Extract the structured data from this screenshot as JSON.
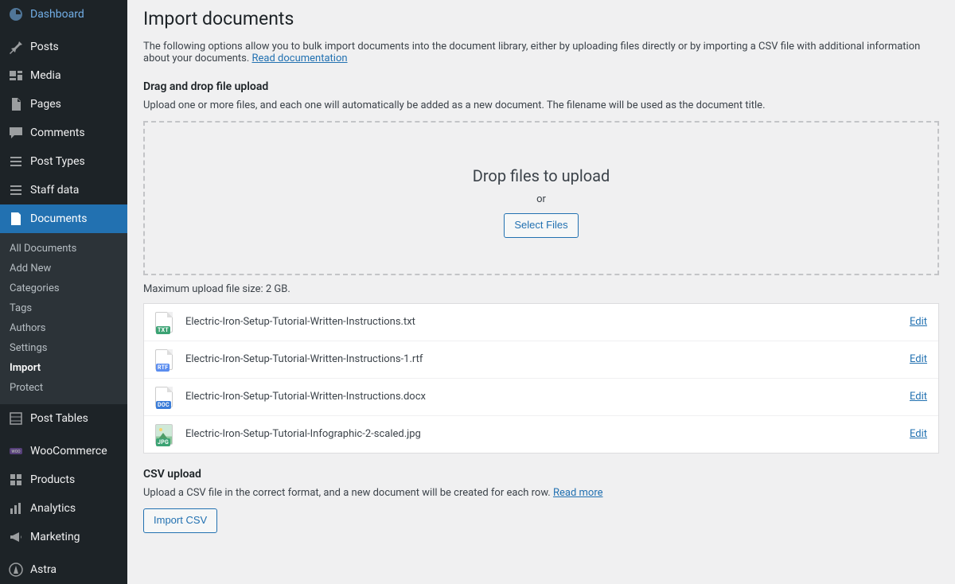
{
  "sidebar": {
    "items": [
      {
        "icon": "dashboard-icon",
        "label": "Dashboard"
      },
      {
        "icon": "pin-icon",
        "label": "Posts"
      },
      {
        "icon": "media-icon",
        "label": "Media"
      },
      {
        "icon": "page-icon",
        "label": "Pages"
      },
      {
        "icon": "comment-icon",
        "label": "Comments"
      },
      {
        "icon": "list-icon",
        "label": "Post Types"
      },
      {
        "icon": "list-icon",
        "label": "Staff data"
      },
      {
        "icon": "document-icon",
        "label": "Documents",
        "current": true
      },
      {
        "icon": "table-icon",
        "label": "Post Tables"
      },
      {
        "icon": "woo-icon",
        "label": "WooCommerce"
      },
      {
        "icon": "product-icon",
        "label": "Products"
      },
      {
        "icon": "analytics-icon",
        "label": "Analytics"
      },
      {
        "icon": "megaphone-icon",
        "label": "Marketing"
      },
      {
        "icon": "astra-icon",
        "label": "Astra"
      }
    ],
    "submenu": [
      {
        "label": "All Documents"
      },
      {
        "label": "Add New"
      },
      {
        "label": "Categories"
      },
      {
        "label": "Tags"
      },
      {
        "label": "Authors"
      },
      {
        "label": "Settings"
      },
      {
        "label": "Import",
        "current": true
      },
      {
        "label": "Protect"
      }
    ]
  },
  "page": {
    "title": "Import documents",
    "intro_text": "The following options allow you to bulk import documents into the document library, either by uploading files directly or by importing a CSV file with additional information about your documents. ",
    "intro_link": "Read documentation",
    "section1_title": "Drag and drop file upload",
    "section1_help": "Upload one or more files, and each one will automatically be added as a new document. The filename will be used as the document title.",
    "dropzone_title": "Drop files to upload",
    "dropzone_or": "or",
    "select_files_btn": "Select Files",
    "max_size": "Maximum upload file size: 2 GB.",
    "edit_label": "Edit",
    "files": [
      {
        "name": "Electric-Iron-Setup-Tutorial-Written-Instructions.txt",
        "type": "txt"
      },
      {
        "name": "Electric-Iron-Setup-Tutorial-Written-Instructions-1.rtf",
        "type": "rtf"
      },
      {
        "name": "Electric-Iron-Setup-Tutorial-Written-Instructions.docx",
        "type": "doc"
      },
      {
        "name": "Electric-Iron-Setup-Tutorial-Infographic-2-scaled.jpg",
        "type": "jpg"
      }
    ],
    "section2_title": "CSV upload",
    "section2_help": "Upload a CSV file in the correct format, and a new document will be created for each row. ",
    "section2_link": "Read more",
    "import_csv_btn": "Import CSV"
  }
}
